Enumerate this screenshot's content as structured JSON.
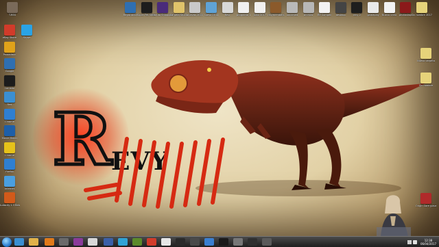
{
  "desktop": {
    "top_icons": [
      {
        "label": "T-REX",
        "color": "#7a6a5a"
      },
      {
        "label": "Registrador",
        "color": "#2f6fb1"
      },
      {
        "label": "Super Pet Sitter",
        "color": "#1d1d1d"
      },
      {
        "label": "Naruto Shippuden",
        "color": "#4a2b7a"
      },
      {
        "label": "Carpeta Studio",
        "color": "#e0c36a"
      },
      {
        "label": "nuevas 2014",
        "color": "#c9c9c9"
      },
      {
        "label": "nuevo 2014",
        "color": "#5fa3d6"
      },
      {
        "label": "Revi",
        "color": "#d8d8d8"
      },
      {
        "label": "programa 1",
        "color": "#f0f0f0"
      },
      {
        "label": "joinx 2017",
        "color": "#f0f0f0"
      },
      {
        "label": "rexymembers",
        "color": "#8b5a2b"
      },
      {
        "label": "unnamed",
        "color": "#b9b9b9"
      },
      {
        "label": "archivo",
        "color": "#b7b7b7"
      },
      {
        "label": "RE Compen",
        "color": "#f2f2f2"
      },
      {
        "label": "desktop",
        "color": "#444444"
      },
      {
        "label": "recy 2",
        "color": "#1e1e1e"
      },
      {
        "label": "gameplay",
        "color": "#e9e9e9"
      },
      {
        "label": "Nuevo crear",
        "color": "#f2f2f2"
      },
      {
        "label": "photoshop",
        "color": "#8b1a1a"
      },
      {
        "label": "Sin nombre 2017",
        "color": "#e6d37a"
      }
    ],
    "left_icons": [
      {
        "label": "eBay Stoire",
        "color": "#d13b2a"
      },
      {
        "label": "Skype",
        "color": "#2aa3e6"
      },
      {
        "label": "Paraadmin",
        "color": "#e0a21a"
      },
      {
        "label": "Google",
        "color": "#2f6fb1"
      },
      {
        "label": "Cambiar",
        "color": "#1c1c1c"
      },
      {
        "label": "Red",
        "color": "#3b8fd1"
      },
      {
        "label": "Chrome",
        "color": "#2f7fd1"
      },
      {
        "label": "Movie Maker",
        "color": "#1e5fa8"
      },
      {
        "label": "Chrome",
        "color": "#e6c21a"
      },
      {
        "label": "Firefox",
        "color": "#2f7fd1"
      },
      {
        "label": "Internet",
        "color": "#4a9fe0"
      },
      {
        "label": "Audacity 1.3 Beta (Uni...",
        "color": "#d25a1a"
      }
    ],
    "right_icons": [
      {
        "label": "Nuevo carpeta",
        "color": "#e6d37a"
      },
      {
        "label": "Sin nombre",
        "color": "#e6d37a"
      },
      {
        "label": "Origin Core (paused)",
        "color": "#b02a2a"
      }
    ]
  },
  "wallpaper": {
    "logo_letter": "R",
    "logo_text": "EVY",
    "accent_color": "#e0331a"
  },
  "taskbar": {
    "start_label": "Start",
    "pinned": [
      {
        "name": "ie",
        "color": "#3b8fd1"
      },
      {
        "name": "explorer",
        "color": "#e0b24a"
      },
      {
        "name": "media",
        "color": "#e07a1a"
      },
      {
        "name": "app1",
        "color": "#6a6a6a"
      },
      {
        "name": "app2",
        "color": "#8a3a9a"
      },
      {
        "name": "app3",
        "color": "#d8d8d8"
      },
      {
        "name": "app4",
        "color": "#3b5fa8"
      },
      {
        "name": "app5",
        "color": "#2fa3d6"
      },
      {
        "name": "app6",
        "color": "#5a8a2a"
      },
      {
        "name": "app7",
        "color": "#d13b2a"
      },
      {
        "name": "app8",
        "color": "#e6e6e6"
      },
      {
        "name": "app9",
        "color": "#2a2a2a"
      },
      {
        "name": "app10",
        "color": "#4a4a4a"
      },
      {
        "name": "app11",
        "color": "#3a7fd1"
      },
      {
        "name": "app12",
        "color": "#1a1a1a"
      },
      {
        "name": "app13",
        "color": "#777777"
      },
      {
        "name": "app14",
        "color": "#2f2f2f"
      },
      {
        "name": "app15",
        "color": "#5a5a5a"
      }
    ],
    "clock_time": "12:38",
    "clock_date": "06/04/2017"
  }
}
